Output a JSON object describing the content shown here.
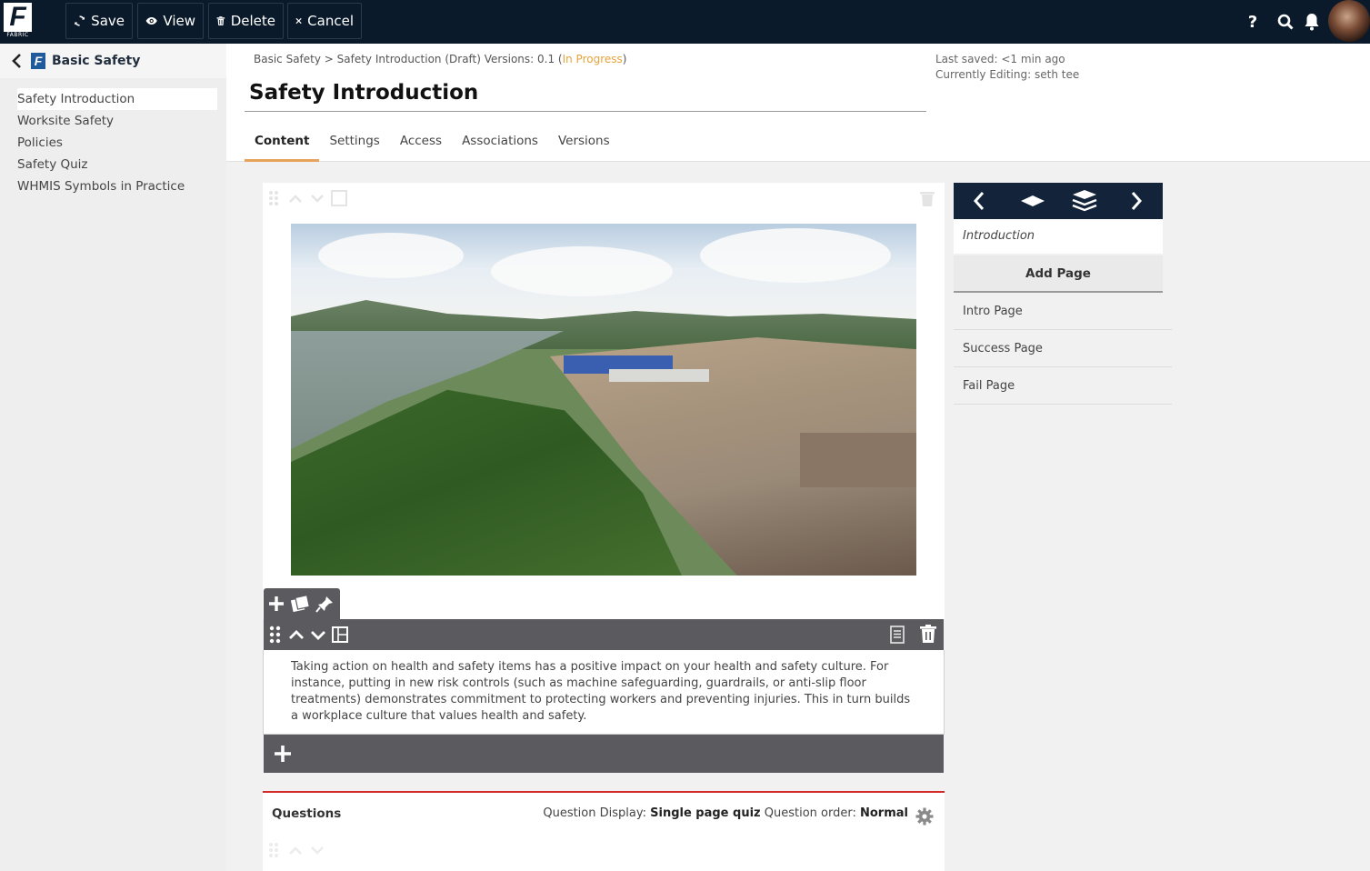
{
  "app": {
    "logo_letter": "F",
    "logo_sub": "FABRIC"
  },
  "toolbar": {
    "save": "Save",
    "view": "View",
    "delete": "Delete",
    "cancel": "Cancel",
    "help": "?"
  },
  "sidebar": {
    "title": "Basic Safety",
    "items": [
      {
        "label": "Safety Introduction"
      },
      {
        "label": "Worksite Safety"
      },
      {
        "label": "Policies"
      },
      {
        "label": "Safety Quiz"
      },
      {
        "label": "WHMIS Symbols in Practice"
      }
    ]
  },
  "header": {
    "crumb_text": "Basic Safety > Safety Introduction (Draft)  Versions: 0.1 (",
    "crumb_status": "In Progress",
    "crumb_close": ")",
    "title": "Safety Introduction",
    "last_saved": "Last saved: <1 min ago",
    "editing": "Currently Editing: seth tee",
    "tabs": [
      {
        "label": "Content"
      },
      {
        "label": "Settings"
      },
      {
        "label": "Access"
      },
      {
        "label": "Associations"
      },
      {
        "label": "Versions"
      }
    ]
  },
  "content": {
    "paragraph": "Taking action on health and safety items has a positive impact on your health and safety culture. For instance, putting in new risk controls (such as machine safeguarding, guardrails, or anti-slip floor treatments) demonstrates commitment to protecting workers and preventing injuries. This in turn builds a workplace culture that values health and safety."
  },
  "questions": {
    "title": "Questions",
    "display_label": "Question Display:",
    "display_value": "Single page quiz",
    "order_label": "Question order:",
    "order_value": "Normal"
  },
  "pages_panel": {
    "current": "Introduction",
    "add_label": "Add Page",
    "pages": [
      {
        "label": "Intro Page"
      },
      {
        "label": "Success Page"
      },
      {
        "label": "Fail Page"
      }
    ]
  },
  "colors": {
    "topbar": "#0b1a2a",
    "accent_tab": "#e8a35a",
    "status_in_progress": "#e6a23c",
    "questions_border": "#d32a2a"
  }
}
